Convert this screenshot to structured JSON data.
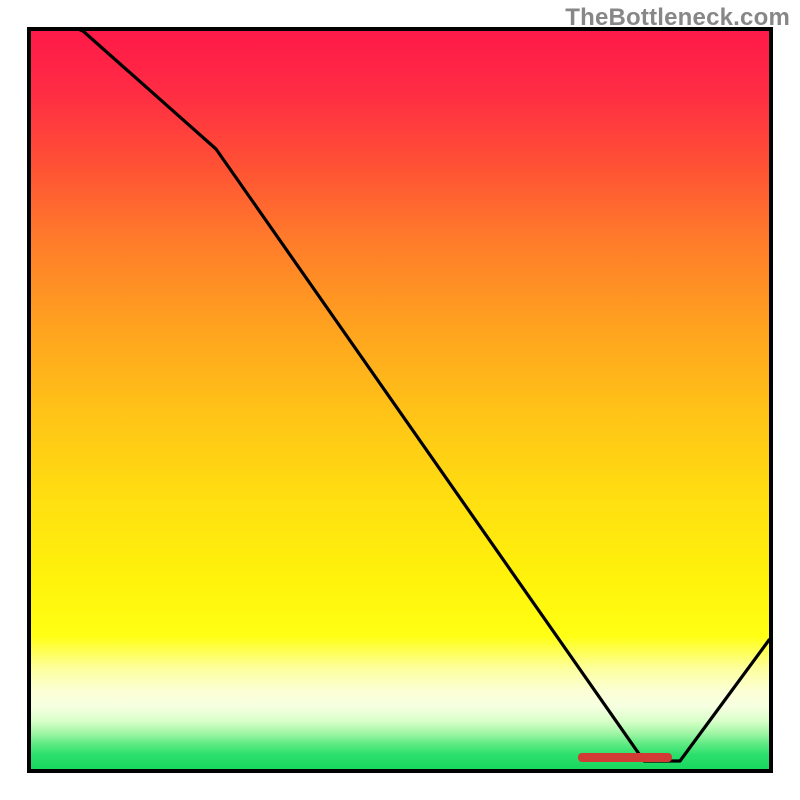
{
  "watermark": "TheBottleneck.com",
  "chart_data": {
    "type": "line",
    "title": "",
    "xlabel": "",
    "ylabel": "",
    "xlim": [
      0,
      100
    ],
    "ylim": [
      0,
      100
    ],
    "x": [
      0,
      7,
      25,
      83,
      88,
      100
    ],
    "values": [
      110,
      100,
      84,
      0.5,
      0.5,
      17
    ],
    "annotations": [
      {
        "label": "marker",
        "x_range": [
          74,
          87
        ],
        "y": 0.6,
        "color": "#d13b33"
      }
    ],
    "background_gradient": {
      "stops": [
        {
          "pos": 0.0,
          "color": "#ff1a49"
        },
        {
          "pos": 0.4,
          "color": "#ffa21f"
        },
        {
          "pos": 0.74,
          "color": "#fff20b"
        },
        {
          "pos": 0.9,
          "color": "#faffdc"
        },
        {
          "pos": 1.0,
          "color": "#17d85e"
        }
      ]
    }
  }
}
